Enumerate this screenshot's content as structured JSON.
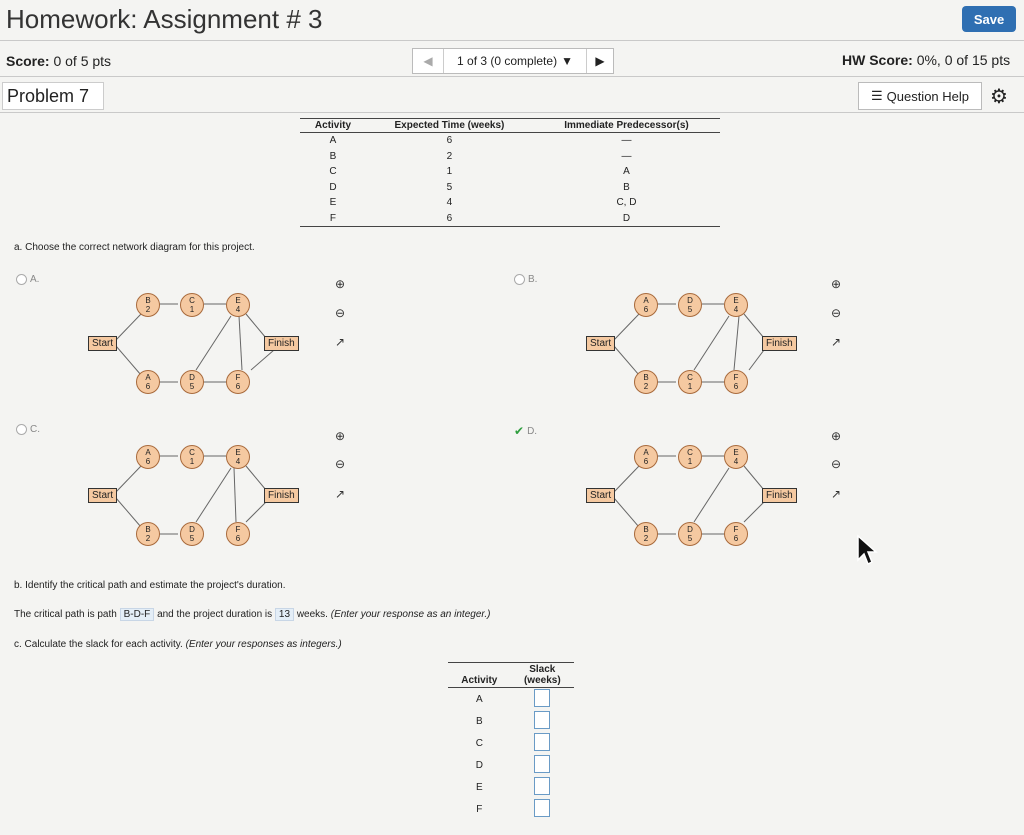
{
  "header": {
    "title": "Homework: Assignment # 3",
    "save_label": "Save"
  },
  "scorebar": {
    "score_label": "Score:",
    "score_value": "0 of 5 pts",
    "nav_text": "1 of 3 (0 complete)",
    "hw_label": "HW Score:",
    "hw_value": "0%, 0 of 15 pts"
  },
  "problem": {
    "label": "Problem 7",
    "help_label": "Question Help"
  },
  "activity_table": {
    "headers": [
      "Activity",
      "Expected Time (weeks)",
      "Immediate Predecessor(s)"
    ],
    "rows": [
      [
        "A",
        "6",
        "—"
      ],
      [
        "B",
        "2",
        "—"
      ],
      [
        "C",
        "1",
        "A"
      ],
      [
        "D",
        "5",
        "B"
      ],
      [
        "E",
        "4",
        "C, D"
      ],
      [
        "F",
        "6",
        "D"
      ]
    ]
  },
  "part_a": {
    "prompt": "a. Choose the correct network diagram for this project.",
    "options": [
      "A.",
      "B.",
      "C.",
      "D."
    ],
    "start_label": "Start",
    "finish_label": "Finish"
  },
  "part_b": {
    "prompt": "b. Identify the critical path and estimate the project's duration.",
    "text1": "The critical path is path",
    "path": "B-D-F",
    "text2": "and the project duration is",
    "duration": "13",
    "text3": "weeks.",
    "hint": "(Enter your response as an integer.)"
  },
  "part_c": {
    "prompt": "c. Calculate the slack for each activity.",
    "hint": "(Enter your responses as integers.)",
    "col1": "Activity",
    "col2a": "Slack",
    "col2b": "(weeks)",
    "activities": [
      "A",
      "B",
      "C",
      "D",
      "E",
      "F"
    ]
  },
  "colors": {
    "node_fill": "#f5c9a1",
    "save": "#2f6fb2",
    "correct": "#2e9e3e"
  }
}
